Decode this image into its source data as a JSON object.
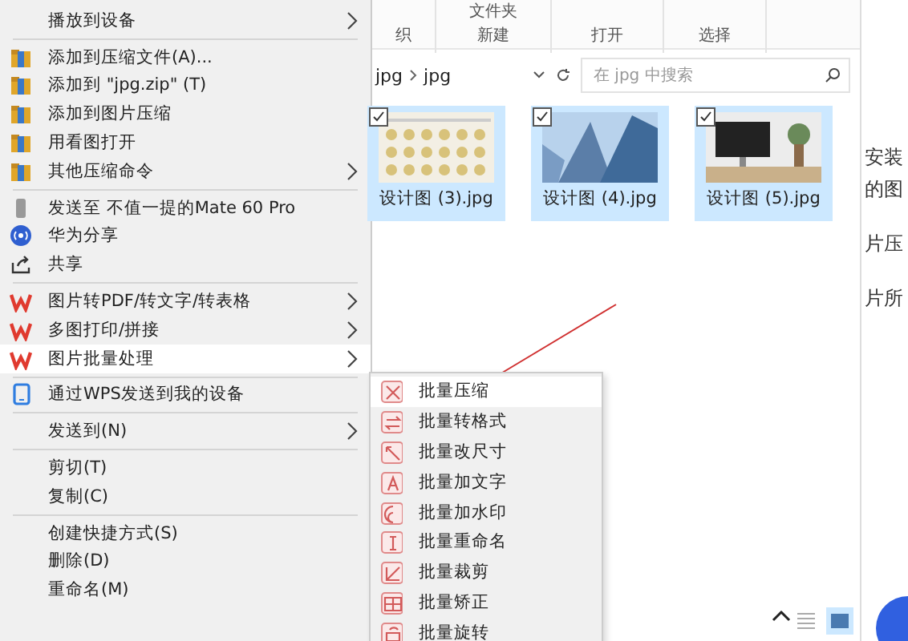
{
  "context_menu": {
    "items": [
      {
        "kind": "item",
        "label": "播放到设备",
        "submenu": true,
        "selected": false
      },
      {
        "kind": "separator"
      },
      {
        "kind": "item",
        "label": "添加到压缩文件(A)...",
        "submenu": false,
        "selected": false
      },
      {
        "kind": "item",
        "label": "添加到 \"jpg.zip\" (T)",
        "submenu": false,
        "selected": false
      },
      {
        "kind": "item",
        "label": "添加到图片压缩",
        "submenu": false,
        "selected": false
      },
      {
        "kind": "item",
        "label": "用看图打开",
        "submenu": false,
        "selected": false
      },
      {
        "kind": "item",
        "label": "其他压缩命令",
        "submenu": true,
        "selected": false
      },
      {
        "kind": "separator"
      },
      {
        "kind": "item",
        "label": "发送至 不值一提的Mate 60 Pro",
        "submenu": false,
        "selected": false
      },
      {
        "kind": "item",
        "label": "华为分享",
        "submenu": false,
        "selected": false
      },
      {
        "kind": "item",
        "label": "共享",
        "submenu": false,
        "selected": false
      },
      {
        "kind": "separator"
      },
      {
        "kind": "item",
        "label": "图片转PDF/转文字/转表格",
        "submenu": true,
        "selected": false
      },
      {
        "kind": "item",
        "label": "多图打印/拼接",
        "submenu": true,
        "selected": false
      },
      {
        "kind": "item",
        "label": "图片批量处理",
        "submenu": true,
        "selected": true
      },
      {
        "kind": "separator"
      },
      {
        "kind": "item",
        "label": "通过WPS发送到我的设备",
        "submenu": false,
        "selected": false
      },
      {
        "kind": "separator"
      },
      {
        "kind": "item",
        "label": "发送到(N)",
        "submenu": true,
        "selected": false
      },
      {
        "kind": "separator"
      },
      {
        "kind": "item",
        "label": "剪切(T)",
        "submenu": false,
        "selected": false
      },
      {
        "kind": "item",
        "label": "复制(C)",
        "submenu": false,
        "selected": false
      },
      {
        "kind": "separator"
      },
      {
        "kind": "item",
        "label": "创建快捷方式(S)",
        "submenu": false,
        "selected": false
      },
      {
        "kind": "item",
        "label": "删除(D)",
        "submenu": false,
        "selected": false
      },
      {
        "kind": "item",
        "label": "重命名(M)",
        "submenu": false,
        "selected": false
      }
    ]
  },
  "submenu": {
    "items": [
      {
        "label": "批量压缩",
        "selected": true
      },
      {
        "label": "批量转格式",
        "selected": false
      },
      {
        "label": "批量改尺寸",
        "selected": false
      },
      {
        "label": "批量加文字",
        "selected": false
      },
      {
        "label": "批量加水印",
        "selected": false
      },
      {
        "label": "批量重命名",
        "selected": false
      },
      {
        "label": "批量裁剪",
        "selected": false
      },
      {
        "label": "批量矫正",
        "selected": false
      },
      {
        "label": "批量旋转",
        "selected": false
      }
    ]
  },
  "explorer": {
    "ribbon": {
      "top_label": "文件夹",
      "groups": [
        "织",
        "新建",
        "打开",
        "选择"
      ]
    },
    "breadcrumb": [
      "jpg",
      "jpg"
    ],
    "search": {
      "placeholder": "在 jpg 中搜索"
    },
    "files": [
      {
        "name": "设计图 (3).jpg",
        "checked": true,
        "selected": true
      },
      {
        "name": "设计图 (4).jpg",
        "checked": true,
        "selected": true
      },
      {
        "name": "设计图 (5).jpg",
        "checked": true,
        "selected": true
      }
    ],
    "view_buttons": [
      {
        "kind": "details",
        "selected": false
      },
      {
        "kind": "thumbnails",
        "selected": true
      }
    ]
  },
  "background_text": [
    "安装",
    "的图",
    "片压",
    "片所"
  ]
}
